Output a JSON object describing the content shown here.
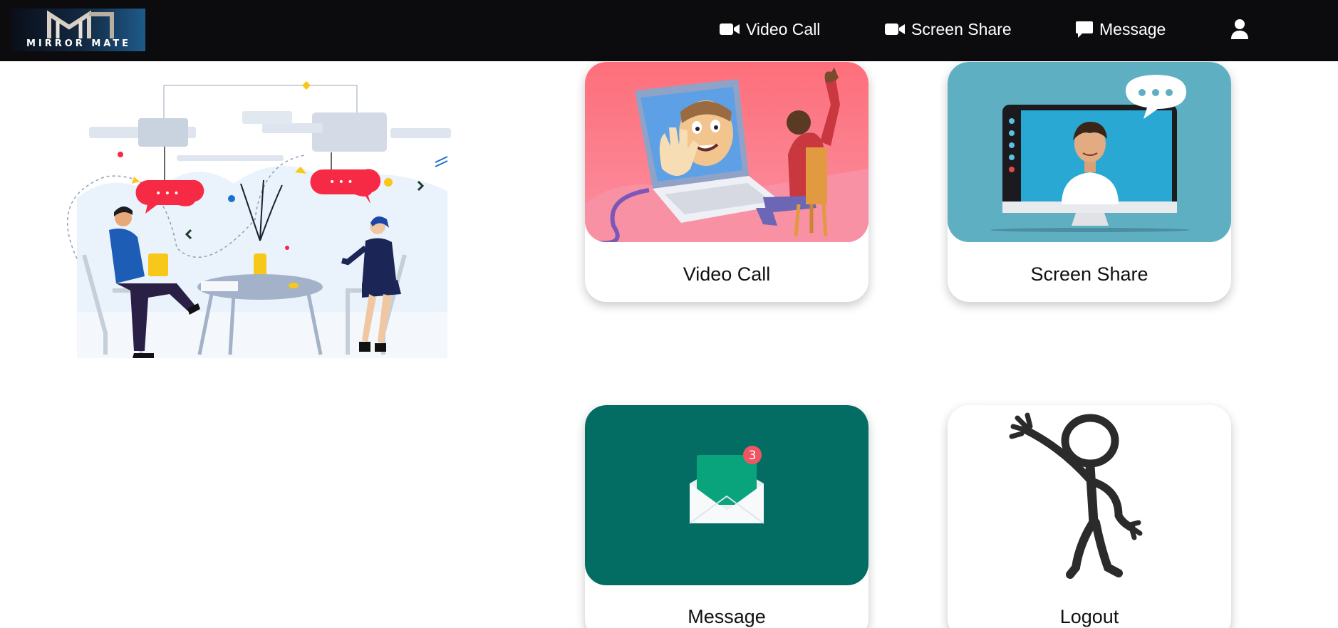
{
  "app": {
    "logo_text": "MIRROR MATE"
  },
  "nav": {
    "items": [
      {
        "label": "Video Call",
        "icon": "video-camera-icon"
      },
      {
        "label": "Screen Share",
        "icon": "video-camera-icon"
      },
      {
        "label": "Message",
        "icon": "chat-bubble-icon"
      }
    ],
    "user_icon": "user-icon"
  },
  "cards": [
    {
      "label": "Video Call",
      "image": "laptop-video-call-illustration"
    },
    {
      "label": "Screen Share",
      "image": "monitor-screen-share-illustration"
    },
    {
      "label": "Message",
      "image": "envelope-message-illustration",
      "badge": "3"
    },
    {
      "label": "Logout",
      "image": "waving-stick-figure-illustration"
    }
  ],
  "colors": {
    "navbar": "#0c0c0e",
    "video_call_bg": "#fd6e7d",
    "screen_share_bg": "#5fafc2",
    "message_bg": "#036d63",
    "badge": "#f05661",
    "speech_bubble": "#f62a45"
  }
}
